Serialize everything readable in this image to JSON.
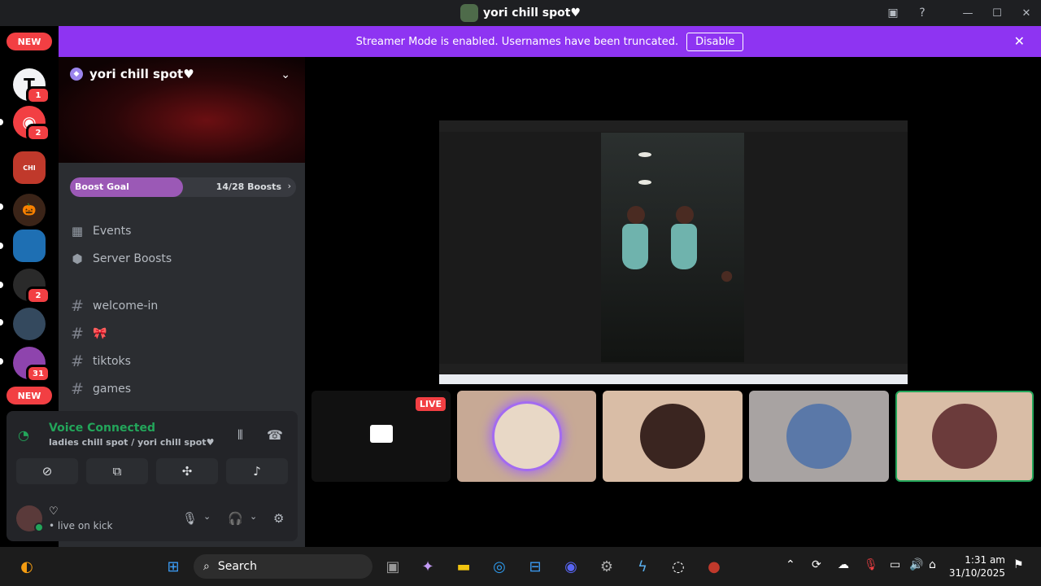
{
  "window": {
    "title": "yori chill spot♥"
  },
  "banner": {
    "message": "Streamer Mode is enabled. Usernames have been truncated.",
    "disable_label": "Disable",
    "close_glyph": "✕"
  },
  "rail": {
    "new_top": "NEW",
    "new_bottom": "NEW",
    "badges": [
      "1",
      "2",
      "2",
      "31"
    ]
  },
  "server": {
    "name": "yori chill spot♥",
    "boost_label": "Boost Goal",
    "boost_count": "14/28 Boosts",
    "boost_progress": 0.5,
    "items": [
      {
        "label": "Events",
        "icon": "calendar-icon"
      },
      {
        "label": "Server Boosts",
        "icon": "boost-icon"
      }
    ],
    "channels": [
      {
        "label": "welcome-in"
      },
      {
        "label": "🎀"
      },
      {
        "label": "tiktoks"
      },
      {
        "label": "games"
      }
    ]
  },
  "voice": {
    "status": "Voice Connected",
    "location": "ladies chill spot / yori chill spot♥"
  },
  "user": {
    "name": "♡",
    "status": "• live on kick"
  },
  "stage": {
    "live_label": "LIVE"
  },
  "taskbar": {
    "search_placeholder": "Search",
    "time": "1:31 am",
    "date": "31/10/2025"
  },
  "colors": {
    "accent": "#8e34f2",
    "voice_green": "#23a55a",
    "danger": "#f23f43"
  }
}
